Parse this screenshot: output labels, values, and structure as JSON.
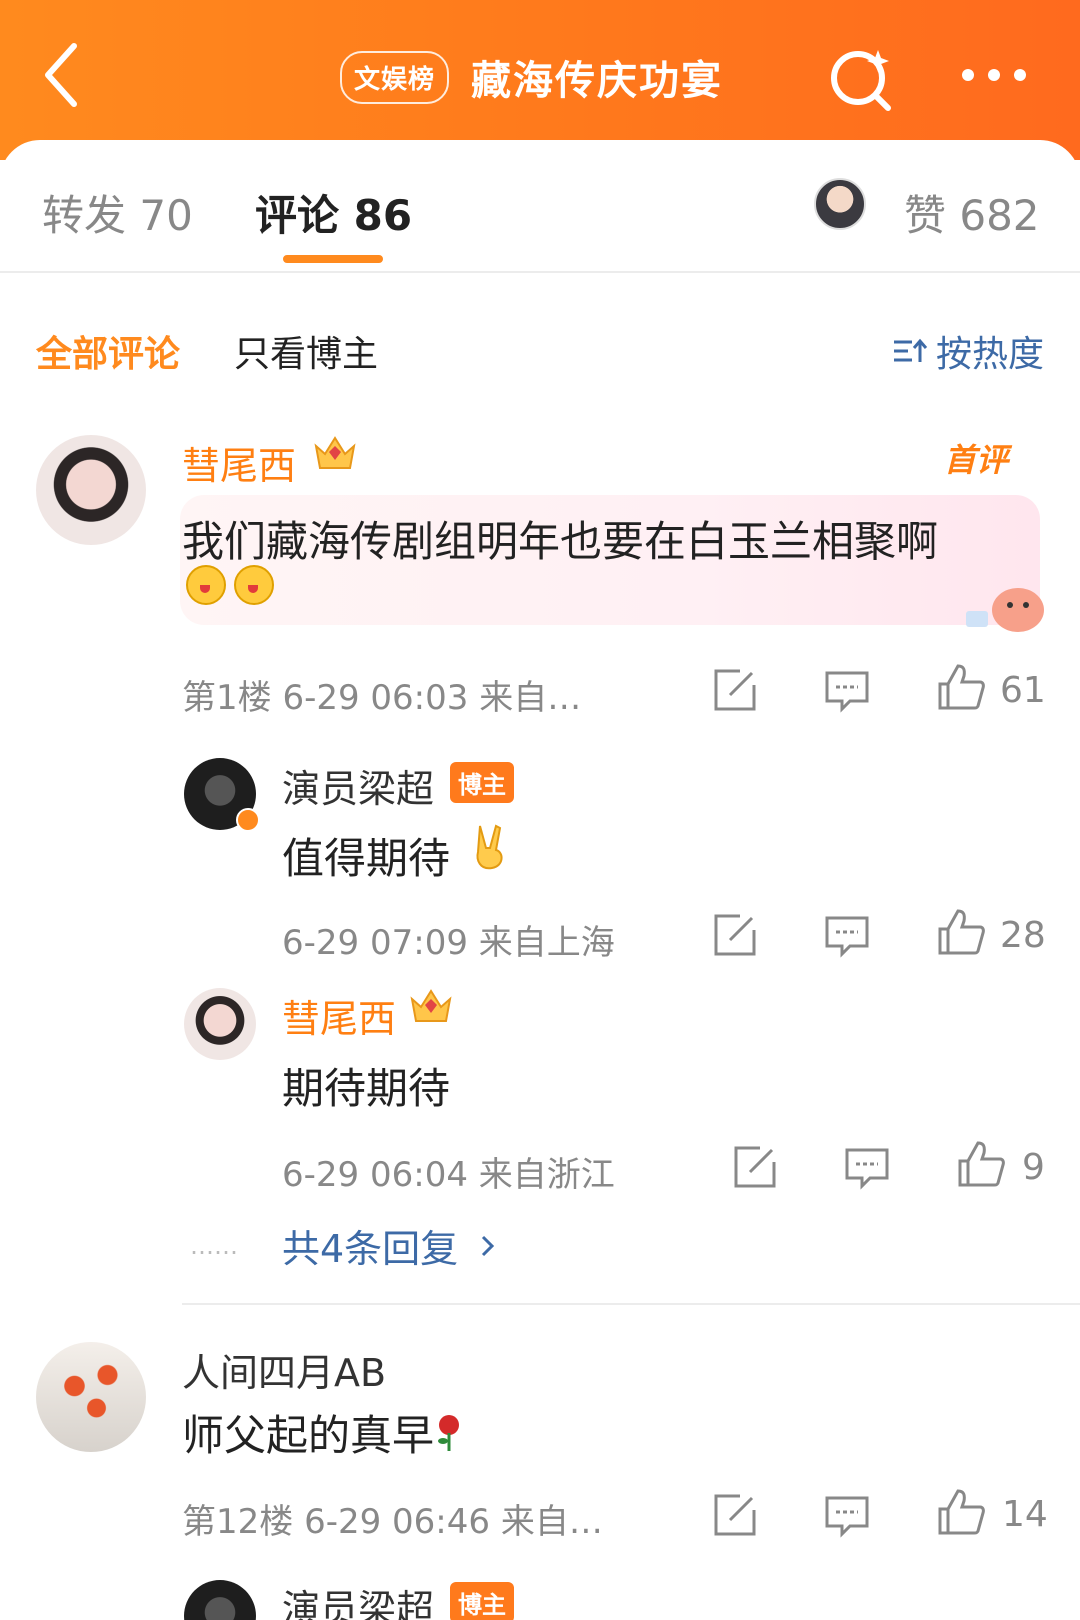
{
  "header": {
    "badge": "文娱榜",
    "title": "藏海传庆功宴"
  },
  "tabs": {
    "repost": "转发 70",
    "comments": "评论 86",
    "likes": "赞 682"
  },
  "filters": {
    "all": "全部评论",
    "blogger_only": "只看博主",
    "sort": "按热度"
  },
  "comments": [
    {
      "user": "彗尾西",
      "first_badge": "首评",
      "text": "我们藏海传剧组明年也要在白玉兰相聚啊",
      "meta": "第1楼 6-29 06:03 来自…",
      "likes": "61"
    },
    {
      "user": "人间四月AB",
      "text": "师父起的真早",
      "meta": "第12楼 6-29 06:46 来自…",
      "likes": "14"
    }
  ],
  "replies": [
    {
      "user": "演员梁超",
      "badge": "博主",
      "text": "值得期待",
      "meta": "6-29 07:09 来自上海",
      "likes": "28"
    },
    {
      "user": "彗尾西",
      "text": "期待期待",
      "meta": "6-29 06:04 来自浙江",
      "likes": "9"
    }
  ],
  "more_replies": "共4条回复",
  "next_reply_user": "演员梁超",
  "next_reply_badge": "博主",
  "colors": {
    "accent": "#ff8a1e",
    "link": "#3d6aa6"
  }
}
